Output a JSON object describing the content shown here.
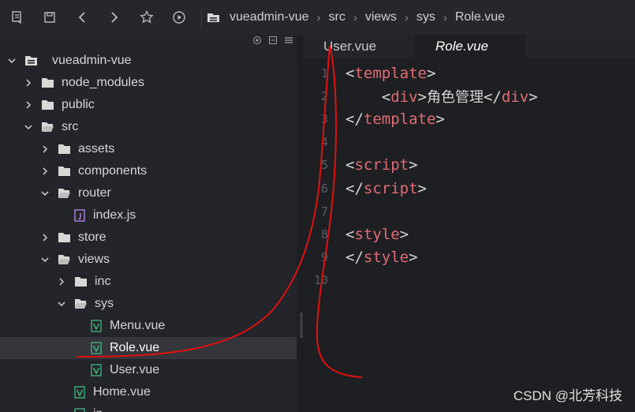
{
  "breadcrumb": [
    "vueadmin-vue",
    "src",
    "views",
    "sys",
    "Role.vue"
  ],
  "toolbar": {
    "icons": [
      "outline-icon",
      "save-icon",
      "back-icon",
      "forward-icon",
      "star-icon",
      "run-icon",
      "folder-icon"
    ]
  },
  "tree": [
    {
      "label": "vueadmin-vue",
      "depth": 0,
      "kind": "root",
      "expanded": true
    },
    {
      "label": "node_modules",
      "depth": 1,
      "kind": "folder",
      "expanded": false
    },
    {
      "label": "public",
      "depth": 1,
      "kind": "folder",
      "expanded": false
    },
    {
      "label": "src",
      "depth": 1,
      "kind": "folder",
      "expanded": true
    },
    {
      "label": "assets",
      "depth": 2,
      "kind": "folder",
      "expanded": false
    },
    {
      "label": "components",
      "depth": 2,
      "kind": "folder",
      "expanded": false
    },
    {
      "label": "router",
      "depth": 2,
      "kind": "folder",
      "expanded": true
    },
    {
      "label": "index.js",
      "depth": 3,
      "kind": "js"
    },
    {
      "label": "store",
      "depth": 2,
      "kind": "folder",
      "expanded": false
    },
    {
      "label": "views",
      "depth": 2,
      "kind": "folder",
      "expanded": true
    },
    {
      "label": "inc",
      "depth": 3,
      "kind": "folder",
      "expanded": false
    },
    {
      "label": "sys",
      "depth": 3,
      "kind": "folder",
      "expanded": true
    },
    {
      "label": "Menu.vue",
      "depth": 4,
      "kind": "vue"
    },
    {
      "label": "Role.vue",
      "depth": 4,
      "kind": "vue",
      "selected": true
    },
    {
      "label": "User.vue",
      "depth": 4,
      "kind": "vue"
    },
    {
      "label": "Home.vue",
      "depth": 3,
      "kind": "vue"
    },
    {
      "label": "in",
      "depth": 3,
      "kind": "vue"
    }
  ],
  "tabs": [
    {
      "label": "User.vue",
      "active": false
    },
    {
      "label": "Role.vue",
      "active": true
    }
  ],
  "code": {
    "line_numbers": [
      "1",
      "2",
      "3",
      "4",
      "5",
      "6",
      "7",
      "8",
      "9",
      "10"
    ],
    "lines": [
      [
        [
          "punc",
          "<"
        ],
        [
          "tag",
          "template"
        ],
        [
          "punc",
          ">"
        ]
      ],
      [
        [
          "punc",
          "    <"
        ],
        [
          "tag",
          "div"
        ],
        [
          "punc",
          ">"
        ],
        [
          "cjk",
          "角色管理"
        ],
        [
          "punc",
          "</"
        ],
        [
          "tag",
          "div"
        ],
        [
          "punc",
          ">"
        ]
      ],
      [
        [
          "punc",
          "</"
        ],
        [
          "tag",
          "template"
        ],
        [
          "punc",
          ">"
        ]
      ],
      [],
      [
        [
          "punc",
          "<"
        ],
        [
          "tag",
          "script"
        ],
        [
          "punc",
          ">"
        ]
      ],
      [
        [
          "punc",
          "</"
        ],
        [
          "tag",
          "script"
        ],
        [
          "punc",
          ">"
        ]
      ],
      [],
      [
        [
          "punc",
          "<"
        ],
        [
          "tag",
          "style"
        ],
        [
          "punc",
          ">"
        ]
      ],
      [
        [
          "punc",
          "</"
        ],
        [
          "tag",
          "style"
        ],
        [
          "punc",
          ">"
        ]
      ],
      []
    ]
  },
  "watermark": "CSDN @北芳科技",
  "colors": {
    "tag": "#e06c75",
    "vue": "#42b883",
    "js": "#b58cf0",
    "folder": "#d8d8d8",
    "annotation": "#e01010"
  }
}
